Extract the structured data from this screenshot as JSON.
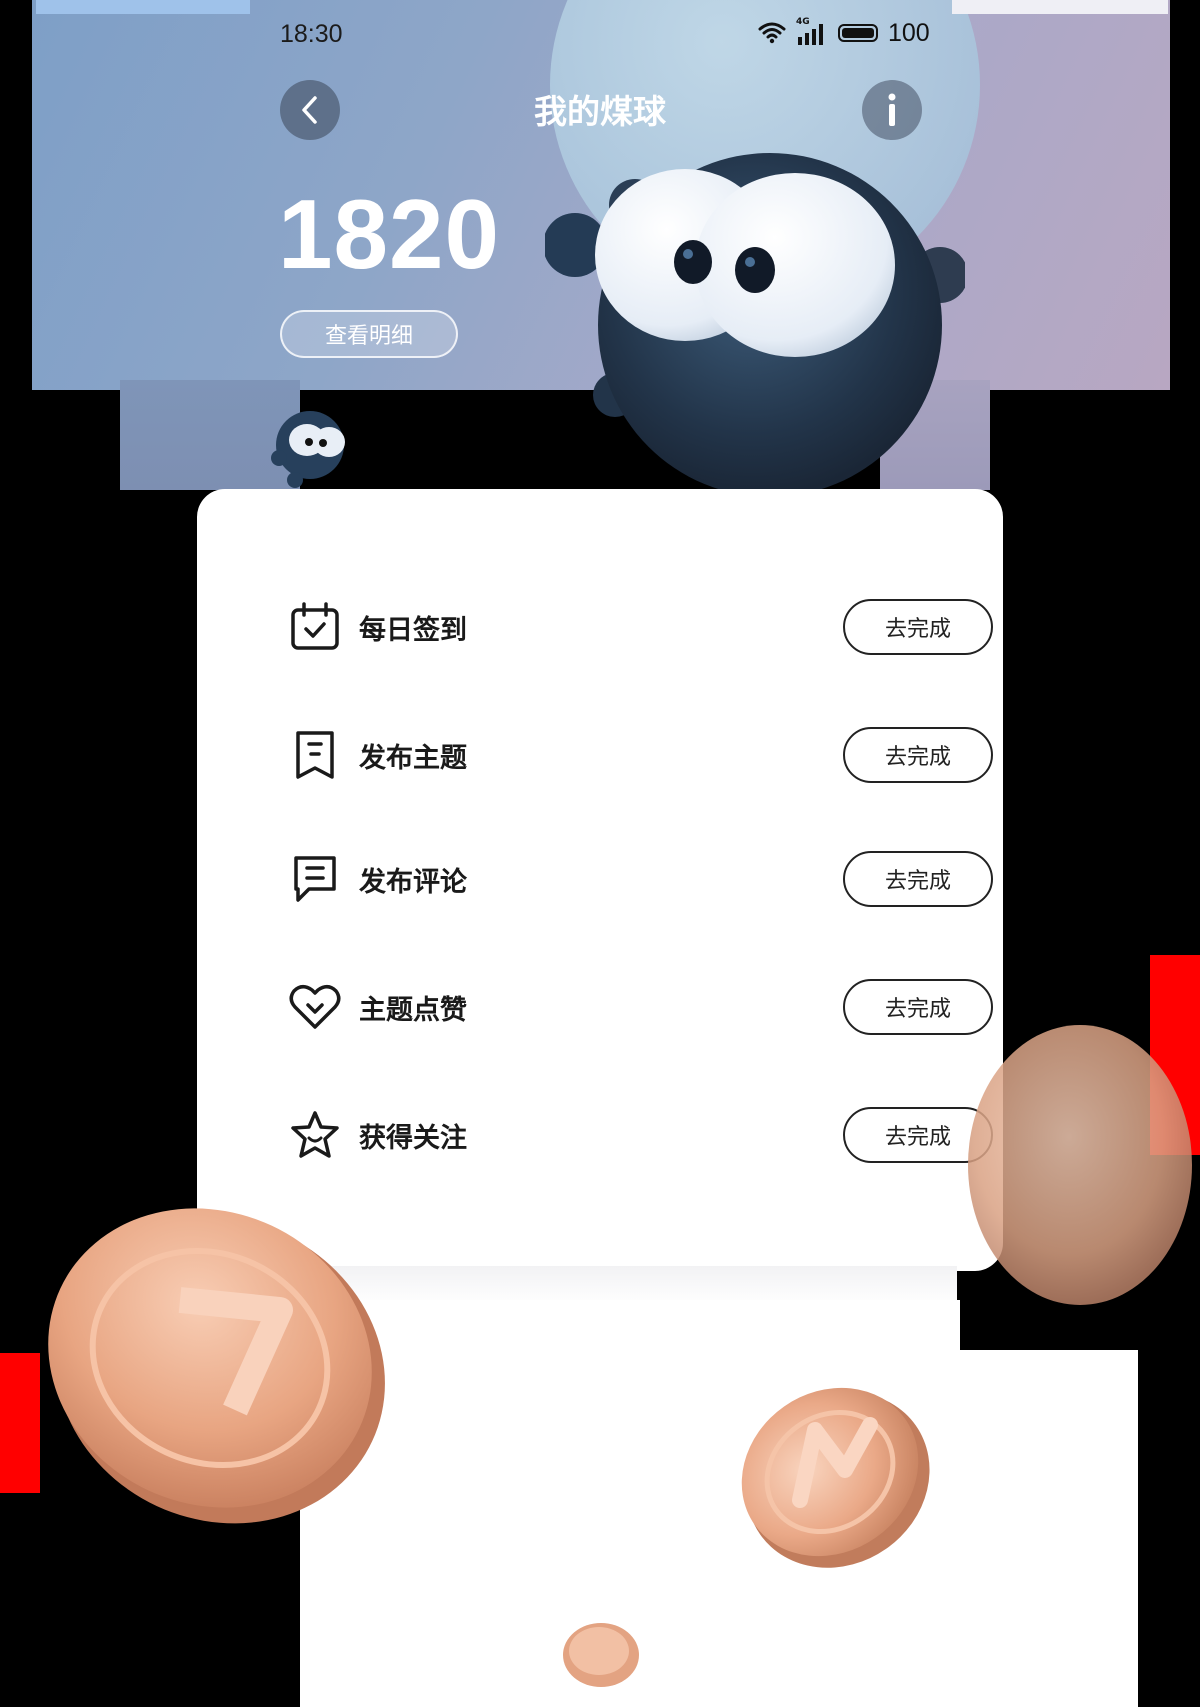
{
  "status_bar": {
    "time": "18:30",
    "network": "4G",
    "battery": "100"
  },
  "header": {
    "title": "我的煤球",
    "back_icon": "chevron-left-icon",
    "info_icon": "info-icon"
  },
  "balance": {
    "value": "1820",
    "detail_label": "查看明细"
  },
  "tasks": [
    {
      "label": "每日签到",
      "icon": "calendar-check-icon",
      "action": "去完成"
    },
    {
      "label": "发布主题",
      "icon": "bookmark-note-icon",
      "action": "去完成"
    },
    {
      "label": "发布评论",
      "icon": "comment-icon",
      "action": "去完成"
    },
    {
      "label": "主题点赞",
      "icon": "heart-icon",
      "action": "去完成"
    },
    {
      "label": "获得关注",
      "icon": "star-icon",
      "action": "去完成"
    }
  ],
  "colors": {
    "hero_start": "#7e9fc7",
    "hero_end": "#b8a7c2",
    "card_bg": "#ffffff",
    "button_border": "#222222",
    "coin": "#e8a582"
  }
}
